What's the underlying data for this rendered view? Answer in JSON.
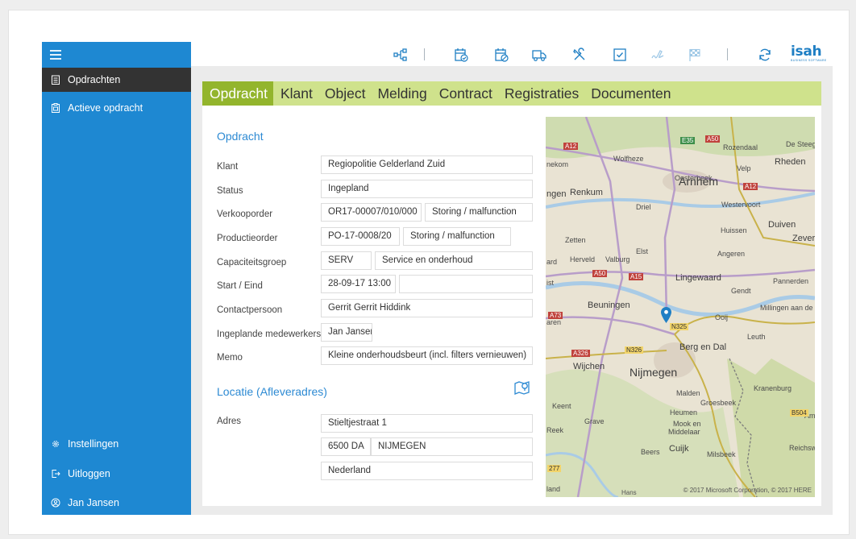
{
  "sidebar": {
    "items": [
      {
        "label": "Opdrachten",
        "icon": "clipboard-list-icon"
      },
      {
        "label": "Actieve opdracht",
        "icon": "clipboard-active-icon"
      }
    ],
    "bottom": [
      {
        "label": "Instellingen",
        "icon": "gear-icon"
      },
      {
        "label": "Uitloggen",
        "icon": "logout-icon"
      },
      {
        "label": "Jan Jansen",
        "icon": "user-icon"
      }
    ]
  },
  "toolbar": {
    "icons": [
      "share-icon",
      "calendar-check-icon",
      "calendar-cancel-icon",
      "truck-icon",
      "tools-icon",
      "checkbox-icon",
      "signature-icon",
      "finish-flag-icon",
      "refresh-icon"
    ],
    "logo": {
      "word": "isah",
      "sub": "BUSINESS SOFTWARE"
    }
  },
  "tabs": [
    {
      "label": "Opdracht",
      "active": true
    },
    {
      "label": "Klant"
    },
    {
      "label": "Object"
    },
    {
      "label": "Melding"
    },
    {
      "label": "Contract"
    },
    {
      "label": "Registraties"
    },
    {
      "label": "Documenten"
    }
  ],
  "opdracht": {
    "title": "Opdracht",
    "klant": {
      "label": "Klant",
      "value": "Regiopolitie Gelderland Zuid"
    },
    "status": {
      "label": "Status",
      "value": "Ingepland"
    },
    "verkooporder": {
      "label": "Verkooporder",
      "value": "OR17-00007/010/000",
      "value2": "Storing / malfunction"
    },
    "productieorder": {
      "label": "Productieorder",
      "value": "PO-17-0008/20",
      "value2": "Storing / malfunction"
    },
    "capaciteitsgroep": {
      "label": "Capaciteitsgroep",
      "value": "SERV",
      "value2": "Service en onderhoud"
    },
    "start_eind": {
      "label": "Start / Eind",
      "value": "28-09-17 13:00",
      "value2": ""
    },
    "contactpersoon": {
      "label": "Contactpersoon",
      "value": "Gerrit Gerrit Hiddink"
    },
    "medewerkers": {
      "label": "Ingeplande medewerkers",
      "value": "Jan Jansen"
    },
    "memo": {
      "label": "Memo",
      "value": "Kleine onderhoudsbeurt (incl. filters vernieuwen)"
    }
  },
  "locatie": {
    "title": "Locatie (Afleveradres)",
    "adres_label": "Adres",
    "straat": "Stieltjestraat 1",
    "postcode": "6500 DA",
    "plaats": "NIJMEGEN",
    "land": "Nederland"
  },
  "map": {
    "labels": {
      "arnhem": "Arnhem",
      "nijmegen": "Nijmegen",
      "renkum": "Renkum",
      "wolfheze": "Wolfheze",
      "oosterbeek": "Oosterbeek",
      "rozendaal": "Rozendaal",
      "de_steeg": "De Steeg",
      "velp": "Velp",
      "rheden": "Rheden",
      "driel": "Driel",
      "westervoort": "Westervoort",
      "duiven": "Duiven",
      "huissen": "Huissen",
      "zevenaar": "Zever",
      "angeren": "Angeren",
      "elst": "Elst",
      "zetten": "Zetten",
      "herveld": "Herveld",
      "valburg": "Valburg",
      "lingewaard": "Lingewaard",
      "gendt": "Gendt",
      "pannerden": "Pannerden",
      "beuningen": "Beuningen",
      "ooij": "Ooij",
      "millingen": "Millingen aan de R",
      "leuth": "Leuth",
      "berg_en_dal": "Berg en Dal",
      "wijchen": "Wijchen",
      "malden": "Malden",
      "groesbeek": "Groesbeek",
      "kranenburg": "Kranenburg",
      "heumen": "Heumen",
      "keent": "Keent",
      "grave": "Grave",
      "mook": "Mook en",
      "middelaar": "Middelaar",
      "reek": "Reek",
      "beers": "Beers",
      "cuijk": "Cuijk",
      "milsbeek": "Milsbeek",
      "reichswald": "Reichswa",
      "nekom": "nekom",
      "ngen": "ngen",
      "ard": "ard",
      "ist": "ist",
      "aren": "aren",
      "land": "land",
      "am": "Am",
      "hans": "Hans"
    },
    "road_shields": [
      "A12",
      "A50",
      "A12",
      "A50",
      "A15",
      "A73",
      "N325",
      "A326",
      "N326",
      "B504",
      "277",
      "E35"
    ],
    "copyright": "© 2017 Microsoft Corporation, © 2017 HERE"
  }
}
